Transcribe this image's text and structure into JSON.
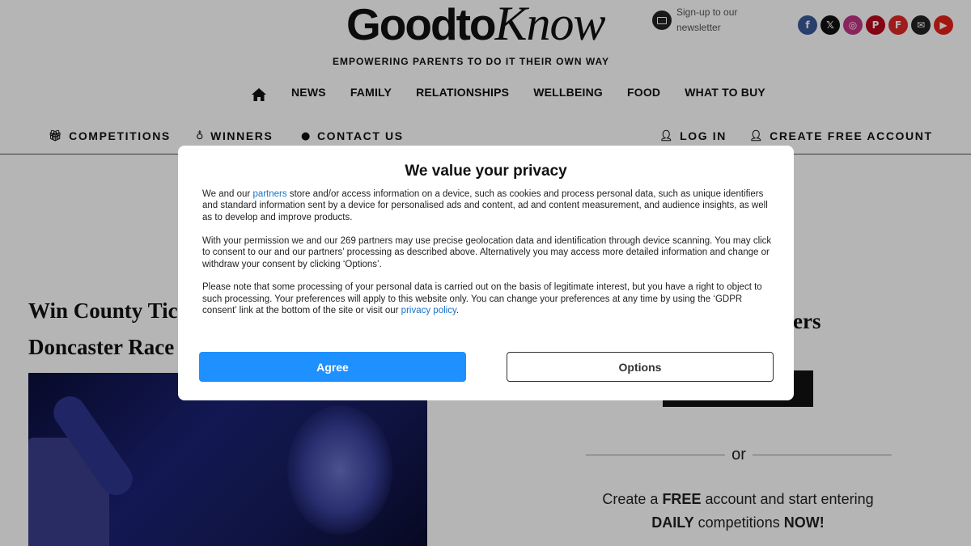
{
  "header": {
    "logo_main": "Goodto",
    "logo_script": "Know",
    "newsletter_label": "Sign-up to our newsletter",
    "tagline": "EMPOWERING PARENTS TO DO IT THEIR OWN WAY",
    "socials": [
      {
        "icon": "facebook-icon",
        "glyph": "f",
        "color": "#3b5998"
      },
      {
        "icon": "x-icon",
        "glyph": "𝕏",
        "color": "#111111"
      },
      {
        "icon": "instagram-icon",
        "glyph": "◎",
        "color": "#c13584"
      },
      {
        "icon": "pinterest-icon",
        "glyph": "P",
        "color": "#bd081c"
      },
      {
        "icon": "flipboard-icon",
        "glyph": "F",
        "color": "#e12828"
      },
      {
        "icon": "email-icon",
        "glyph": "✉",
        "color": "#222222"
      },
      {
        "icon": "youtube-icon",
        "glyph": "▶",
        "color": "#e62117"
      }
    ]
  },
  "main_nav": [
    "NEWS",
    "FAMILY",
    "RELATIONSHIPS",
    "WELLBEING",
    "FOOD",
    "WHAT TO BUY"
  ],
  "sub_nav": {
    "competitions": "COMPETITIONS",
    "winners": "WINNERS",
    "contact": "CONTACT US",
    "login": "LOG IN",
    "create_account": "CREATE FREE ACCOUNT"
  },
  "article": {
    "title_line1": "Win County Tic",
    "title_line2": "Doncaster Race"
  },
  "sidebar": {
    "heading_fragment": "ers",
    "or": "or",
    "copy_prefix": "Create a ",
    "copy_free": "FREE",
    "copy_middle": " account and start entering",
    "copy_daily": "DAILY",
    "copy_mid2": " competitions ",
    "copy_now": "NOW!"
  },
  "consent": {
    "title": "We value your privacy",
    "p1_before": "We and our ",
    "p1_link": "partners",
    "p1_after": " store and/or access information on a device, such as cookies and process personal data, such as unique identifiers and standard information sent by a device for personalised ads and content, ad and content measurement, and audience insights, as well as to develop and improve products.",
    "p2": "With your permission we and our 269 partners may use precise geolocation data and identification through device scanning. You may click to consent to our and our partners’ processing as described above. Alternatively you may access more detailed information and change or withdraw your consent by clicking ‘Options’.",
    "p3_before": "Please note that some processing of your personal data is carried out on the basis of legitimate interest, but you have a right to object to such processing. Your preferences will apply to this website only. You can change your preferences at any time by using the ‘GDPR consent’ link at the bottom of the site or visit our ",
    "p3_link": "privacy policy",
    "p3_after": ".",
    "agree": "Agree",
    "options": "Options"
  }
}
